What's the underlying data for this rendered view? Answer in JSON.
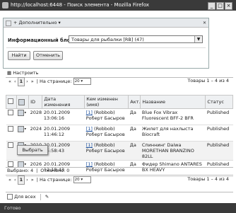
{
  "window": {
    "title": "http://localhost:6448 - Поиск элемента - Mozilla Firefox",
    "min": "_",
    "max": "□",
    "close": "×"
  },
  "filter": {
    "add_more": "Дополнительно",
    "label": "Информационный блок:",
    "select_value": "Товары для рыбалки [RB] (47)",
    "find_button": "Найти",
    "cancel_button": "Отменить"
  },
  "settings_button": "Настроить",
  "pager": {
    "first": "«",
    "prev": "‹",
    "page": "1",
    "next": "›",
    "last": "»",
    "per_page_label": "На странице:",
    "per_page_value": "20",
    "total": "Товары 1 – 4 из 4"
  },
  "grid": {
    "columns": [
      "ID",
      "Дата изменения",
      "Кем изменен (имя)",
      "Акт.",
      "Название",
      "Статус"
    ],
    "rows": [
      {
        "id": "2028",
        "date": "20.01.2009",
        "time": "13:06:16",
        "user_link": "[1]",
        "user_login": "(Robbob)",
        "user_name": "Роберт Басыров",
        "active": "Да",
        "name": "Blue Fox Vibrax Fluorescent BFF-2 BFR",
        "status": "Published"
      },
      {
        "id": "2024",
        "date": "20.01.2009",
        "time": "11:46:12",
        "user_link": "[1]",
        "user_login": "(Robbob)",
        "user_name": "Роберт Басыров",
        "active": "Да",
        "name": "Жилет для нахлыста Biocraft",
        "status": "Published"
      },
      {
        "id": "2010",
        "date": "20.01.2009",
        "time": "15:58:43",
        "user_link": "[1]",
        "user_login": "(Robbob)",
        "user_name": "Роберт Басыров",
        "active": "Да",
        "name": "Спиннинг Daiwa MORETHAN BRANZINO 82LL",
        "status": "Published"
      },
      {
        "id": "2026",
        "date": "20.01.2009",
        "time": "12:18:43",
        "user_link": "[1]",
        "user_login": "(Robbob)",
        "user_name": "Роберт Басыров",
        "active": "Да",
        "name": "Фидер Shimano ANTARES BX HEAVY",
        "status": "Published"
      }
    ],
    "popup_item": "Выбрать"
  },
  "footer": {
    "selected": "Выбрано: 4",
    "marked": "Отмечено: 0"
  },
  "actions": {
    "for_all": "Для всех"
  },
  "status_bar": {
    "text": "Готово"
  }
}
